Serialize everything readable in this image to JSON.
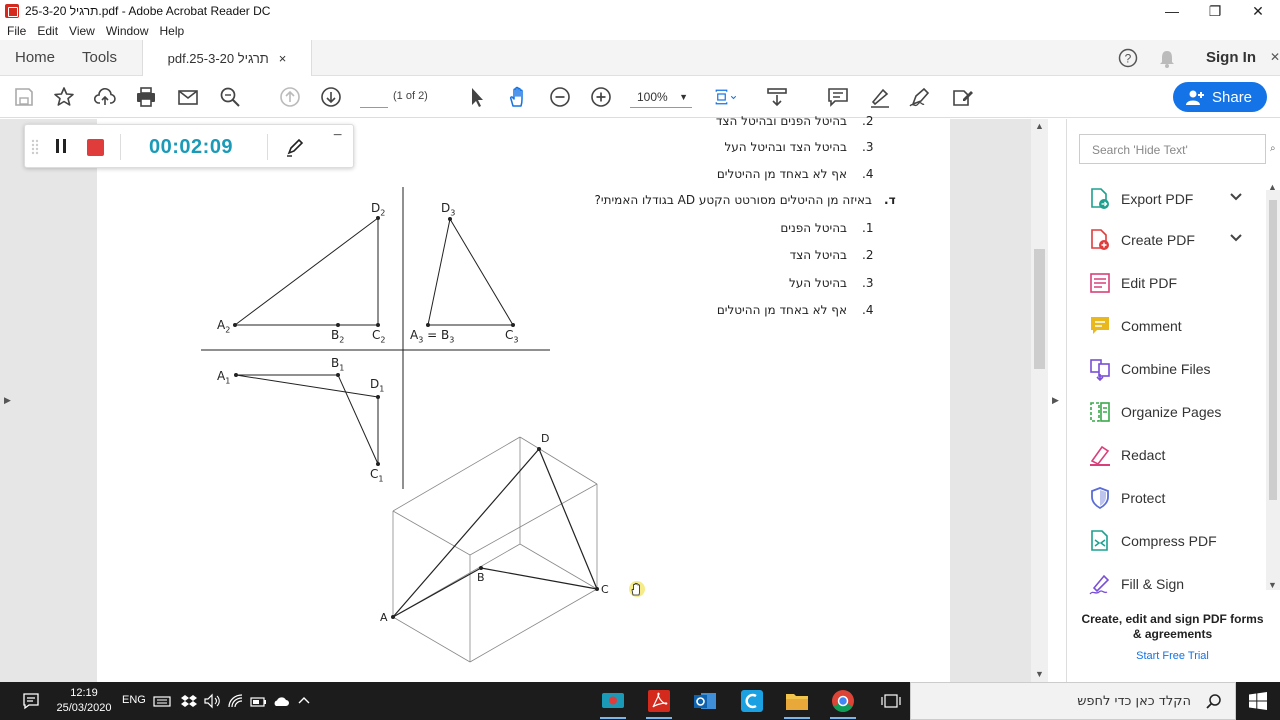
{
  "window": {
    "title": "25-3-20 תרגיל.pdf - Adobe Acrobat Reader DC",
    "minimize": "—",
    "restore": "❐",
    "close": "✕"
  },
  "menu": [
    "File",
    "Edit",
    "View",
    "Window",
    "Help"
  ],
  "tabs": {
    "home": "Home",
    "tools": "Tools",
    "doc": "pdf.25-3-20 תרגיל",
    "close": "×",
    "signin": "Sign In"
  },
  "toolbar": {
    "page_current": "",
    "page_count": "(1 of 2)",
    "zoom": "100%",
    "share": "Share"
  },
  "timer": {
    "time": "00:02:09",
    "minimize": "−"
  },
  "document": {
    "lines": [
      {
        "num": ".2",
        "text": "בהיטל הפנים ובהיטל הצד"
      },
      {
        "num": ".3",
        "text": "בהיטל הצד ובהיטל העל"
      },
      {
        "num": ".4",
        "text": "אף לא באחד מן ההיטלים"
      },
      {
        "num": ".ד",
        "text": "באיזה מן ההיטלים מסורטט הקטע AD בגודלו האמיתי?"
      },
      {
        "num": ".1",
        "text": "בהיטל הפנים"
      },
      {
        "num": ".2",
        "text": "בהיטל הצד"
      },
      {
        "num": ".3",
        "text": "בהיטל העל"
      },
      {
        "num": ".4",
        "text": "אף לא באחד מן ההיטלים"
      }
    ],
    "labels": {
      "D2": "D",
      "D2s": "2",
      "A2": "A",
      "A2s": "2",
      "B2": "B",
      "B2s": "2",
      "C2": "C",
      "C2s": "2",
      "D3": "D",
      "D3s": "3",
      "A3B3": "A",
      "A3s": "3",
      "eq": " = B",
      "B3s": "3",
      "C3": "C",
      "C3s": "3",
      "A1": "A",
      "A1s": "1",
      "B1": "B",
      "B1s": "1",
      "D1": "D",
      "D1s": "1",
      "C1": "C",
      "C1s": "1",
      "D": "D",
      "B": "B",
      "C": "C",
      "A": "A"
    }
  },
  "right_panel": {
    "search_placeholder": "Search 'Hide Text'",
    "tools": [
      {
        "label": "Export PDF",
        "color": "#1e9f8f"
      },
      {
        "label": "Create PDF",
        "color": "#e03c3c"
      },
      {
        "label": "Edit PDF",
        "color": "#d9407a"
      },
      {
        "label": "Comment",
        "color": "#e8b81c"
      },
      {
        "label": "Combine Files",
        "color": "#7a4fd6"
      },
      {
        "label": "Organize Pages",
        "color": "#3aa84a"
      },
      {
        "label": "Redact",
        "color": "#d9407a"
      },
      {
        "label": "Protect",
        "color": "#5a6dd6"
      },
      {
        "label": "Compress PDF",
        "color": "#1e9f8f"
      },
      {
        "label": "Fill & Sign",
        "color": "#7a4fd6"
      }
    ],
    "promo_title": "Create, edit and sign PDF forms & agreements",
    "promo_link": "Start Free Trial"
  },
  "taskbar": {
    "time": "12:19",
    "date": "25/03/2020",
    "lang": "ENG",
    "search": "הקלד כאן כדי לחפש"
  }
}
